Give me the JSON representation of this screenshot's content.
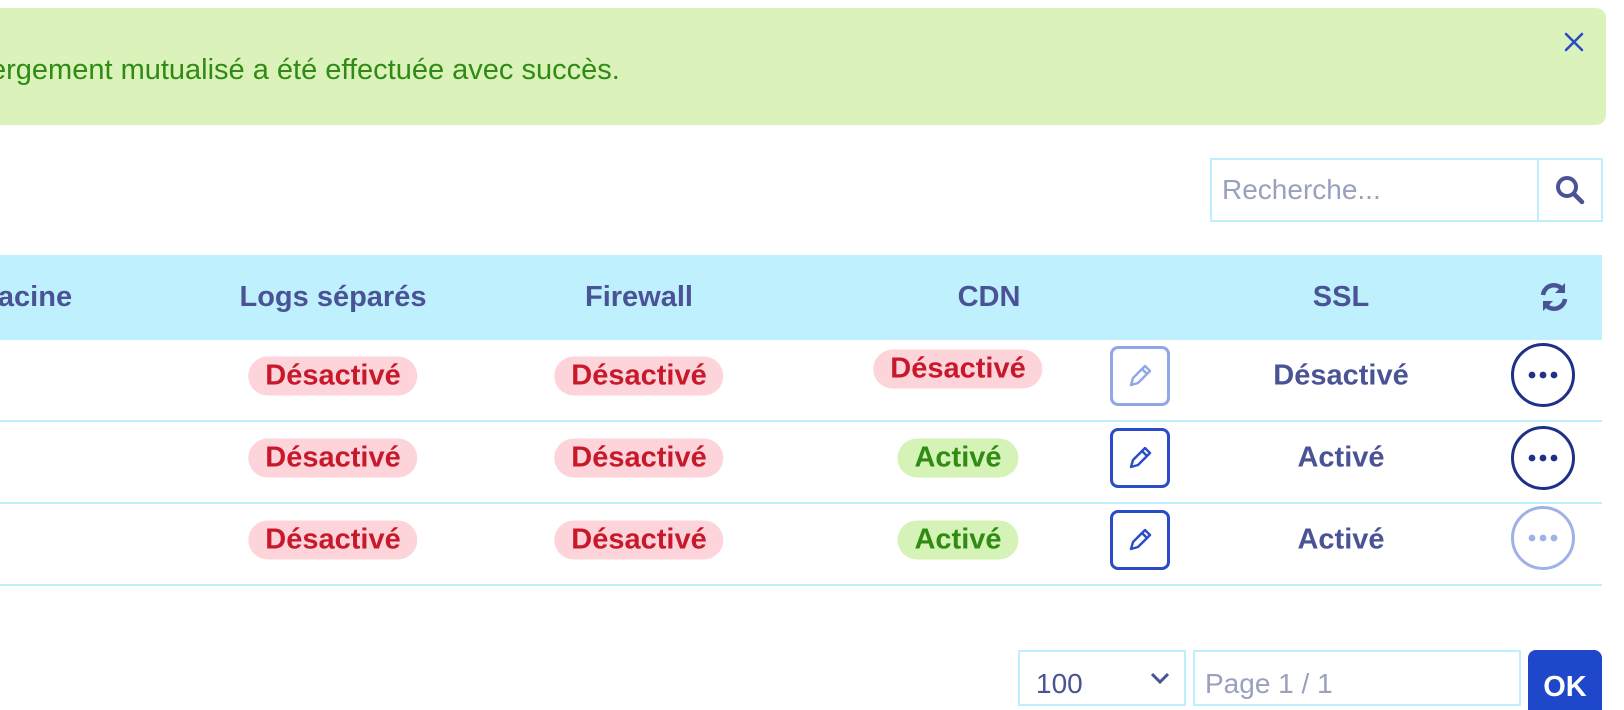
{
  "alert": {
    "message": "ergement mutualisé a été effectuée avec succès.",
    "close_icon": "close-icon"
  },
  "search": {
    "placeholder": "Recherche...",
    "icon": "search-icon"
  },
  "table": {
    "headers": {
      "root": "acine",
      "logs": "Logs séparés",
      "firewall": "Firewall",
      "cdn": "CDN",
      "ssl": "SSL",
      "refresh_icon": "refresh-icon"
    },
    "rows": [
      {
        "logs": "Désactivé",
        "firewall": "Désactivé",
        "cdn": "Désactivé",
        "ssl": "Désactivé"
      },
      {
        "logs": "Désactivé",
        "firewall": "Désactivé",
        "cdn": "Activé",
        "ssl": "Activé"
      },
      {
        "logs": "Désactivé",
        "firewall": "Désactivé",
        "cdn": "Activé",
        "ssl": "Activé"
      }
    ]
  },
  "pagination": {
    "per_page": "100",
    "page_placeholder": "Page 1 / 1",
    "ok_label": "OK"
  },
  "colors": {
    "success_bg": "#dcf2bb",
    "success_text": "#2f8b14",
    "header_bg": "#bff0fd",
    "danger_bg": "#fcd4da",
    "danger_text": "#c8182c",
    "primary": "#1e47c9",
    "text": "#4a5396"
  }
}
